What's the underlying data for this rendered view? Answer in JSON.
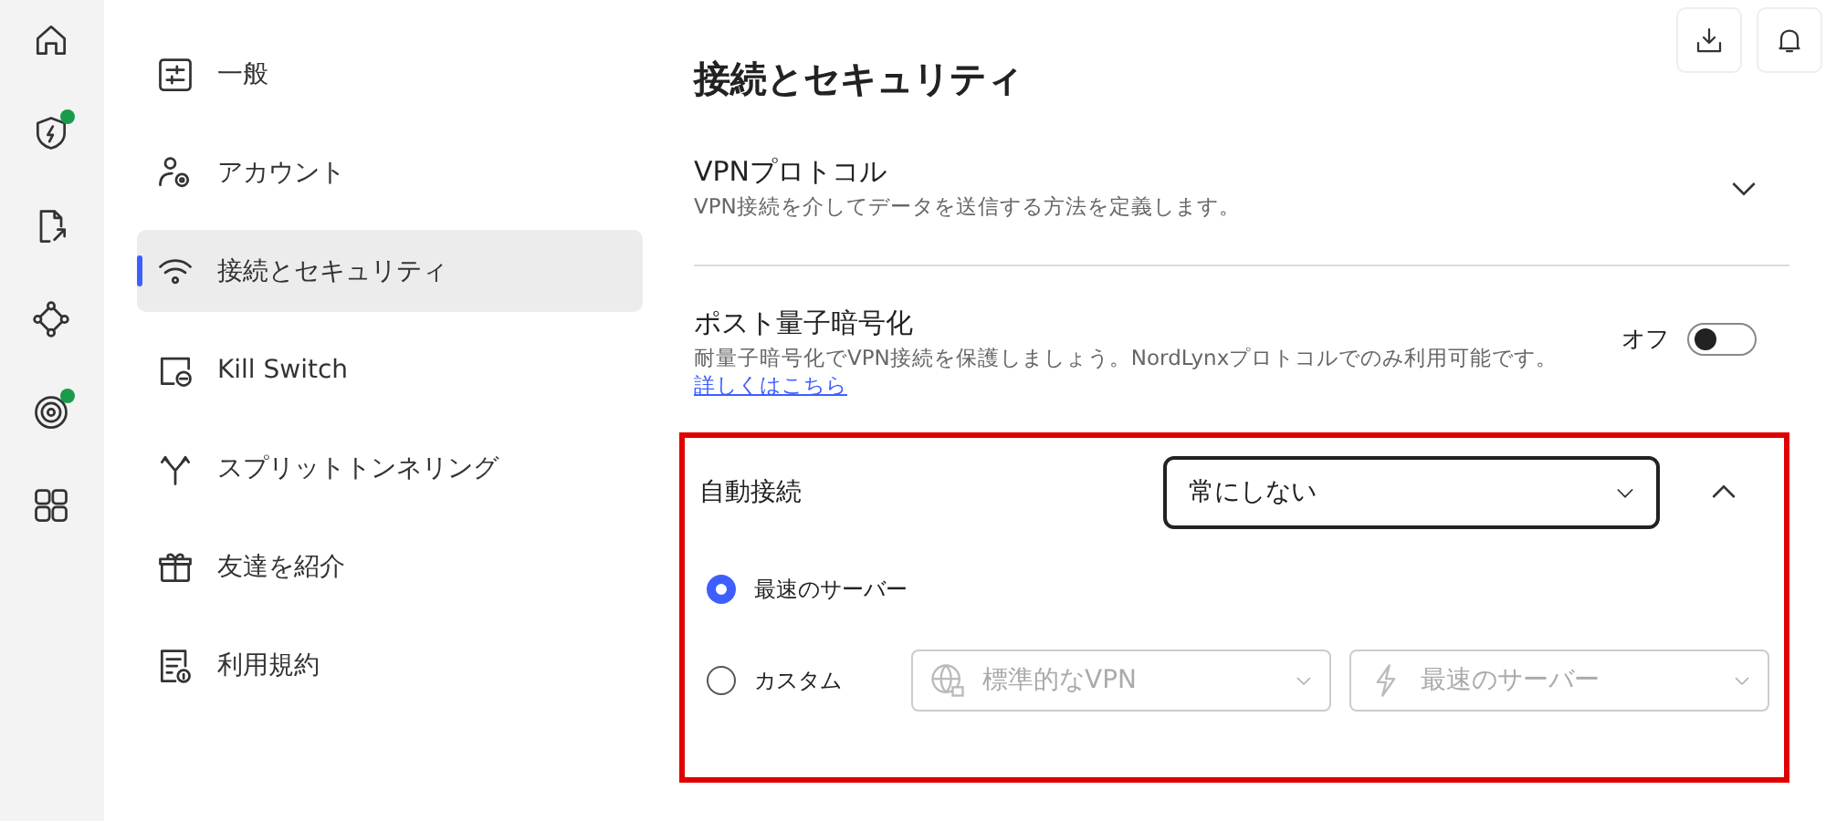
{
  "rail": {
    "items": [
      {
        "kind": "home",
        "badge": false
      },
      {
        "kind": "shield",
        "badge": true
      },
      {
        "kind": "share",
        "badge": false
      },
      {
        "kind": "mesh",
        "badge": false
      },
      {
        "kind": "target",
        "badge": true
      },
      {
        "kind": "apps",
        "badge": false
      }
    ]
  },
  "sidebar": {
    "items": [
      {
        "label": "一般",
        "kind": "sliders",
        "selected": false
      },
      {
        "label": "アカウント",
        "kind": "account",
        "selected": false
      },
      {
        "label": "接続とセキュリティ",
        "kind": "wifi",
        "selected": true
      },
      {
        "label": "Kill Switch",
        "kind": "killswitch",
        "selected": false
      },
      {
        "label": "スプリットトンネリング",
        "kind": "split",
        "selected": false
      },
      {
        "label": "友達を紹介",
        "kind": "gift",
        "selected": false
      },
      {
        "label": "利用規約",
        "kind": "terms",
        "selected": false
      }
    ]
  },
  "toolbar": [
    {
      "kind": "download"
    },
    {
      "kind": "bell"
    }
  ],
  "page_title": "接続とセキュリティ",
  "vpn_protocol": {
    "title": "VPNプロトコル",
    "description": "VPN接続を介してデータを送信する方法を定義します。",
    "expanded": false
  },
  "post_quantum": {
    "title": "ポスト量子暗号化",
    "description": "耐量子暗号化でVPN接続を保護しましょう。NordLynxプロトコルでのみ利用可能です。",
    "link": "詳しくはこちら",
    "toggle": {
      "label": "オフ",
      "on": false
    }
  },
  "auto_connect": {
    "title": "自動接続",
    "highlighted": true,
    "expanded": true,
    "dropdown": {
      "value": "常にしない"
    },
    "options": [
      {
        "label": "最速のサーバー",
        "selected": true
      },
      {
        "label": "カスタム",
        "selected": false,
        "dropdowns": [
          {
            "kind": "globe",
            "value": "標準的なVPN",
            "disabled": true
          },
          {
            "kind": "bolt",
            "value": "最速のサーバー",
            "disabled": true
          }
        ]
      }
    ]
  }
}
